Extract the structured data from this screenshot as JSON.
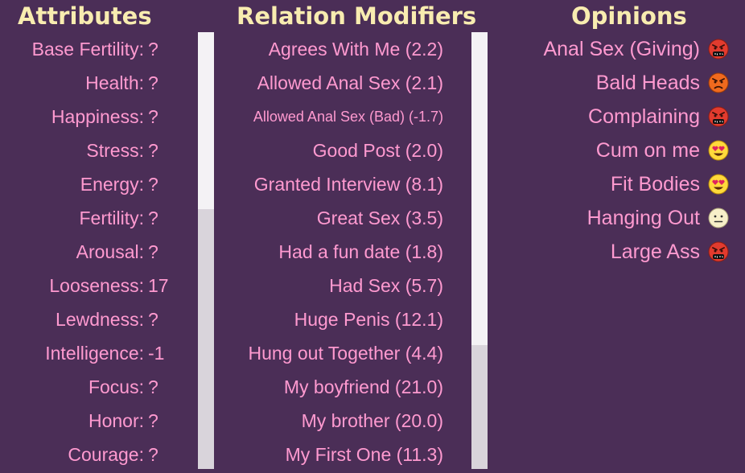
{
  "headings": {
    "attributes": "Attributes",
    "relation_modifiers": "Relation Modifiers",
    "opinions": "Opinions"
  },
  "attributes": [
    {
      "label": "Base Fertility:",
      "value": "?"
    },
    {
      "label": "Health:",
      "value": "?"
    },
    {
      "label": "Happiness:",
      "value": "?"
    },
    {
      "label": "Stress:",
      "value": "?"
    },
    {
      "label": "Energy:",
      "value": "?"
    },
    {
      "label": "Fertility:",
      "value": "?"
    },
    {
      "label": "Arousal:",
      "value": "?"
    },
    {
      "label": "Looseness:",
      "value": "17"
    },
    {
      "label": "Lewdness:",
      "value": "?"
    },
    {
      "label": "Intelligence:",
      "value": "-1"
    },
    {
      "label": "Focus:",
      "value": "?"
    },
    {
      "label": "Honor:",
      "value": "?"
    },
    {
      "label": "Courage:",
      "value": "?"
    }
  ],
  "relation_modifiers": [
    "Agrees With Me (2.2)",
    "Allowed Anal Sex (2.1)",
    "Allowed Anal Sex (Bad) (-1.7)",
    "Good Post (2.0)",
    "Granted Interview (8.1)",
    "Great Sex (3.5)",
    "Had a fun date (1.8)",
    "Had Sex (5.7)",
    "Huge Penis (12.1)",
    "Hung out Together (4.4)",
    "My boyfriend (21.0)",
    "My brother (20.0)",
    "My First One (11.3)"
  ],
  "opinions": [
    {
      "label": "Anal Sex (Giving)",
      "icon": "angry-cursing-face-icon"
    },
    {
      "label": "Bald Heads",
      "icon": "angry-face-icon"
    },
    {
      "label": "Complaining",
      "icon": "angry-cursing-face-icon"
    },
    {
      "label": "Cum on me",
      "icon": "heart-eyes-face-icon"
    },
    {
      "label": "Fit Bodies",
      "icon": "heart-eyes-face-icon"
    },
    {
      "label": "Hanging Out",
      "icon": "neutral-face-icon"
    },
    {
      "label": "Large Ass",
      "icon": "angry-cursing-face-icon"
    }
  ],
  "colors": {
    "background": "#4b2e57",
    "heading": "#f8ecb0",
    "text": "#ff9ad0",
    "scroll_track": "#d9d4db",
    "scroll_thumb": "#f4f2f5"
  }
}
